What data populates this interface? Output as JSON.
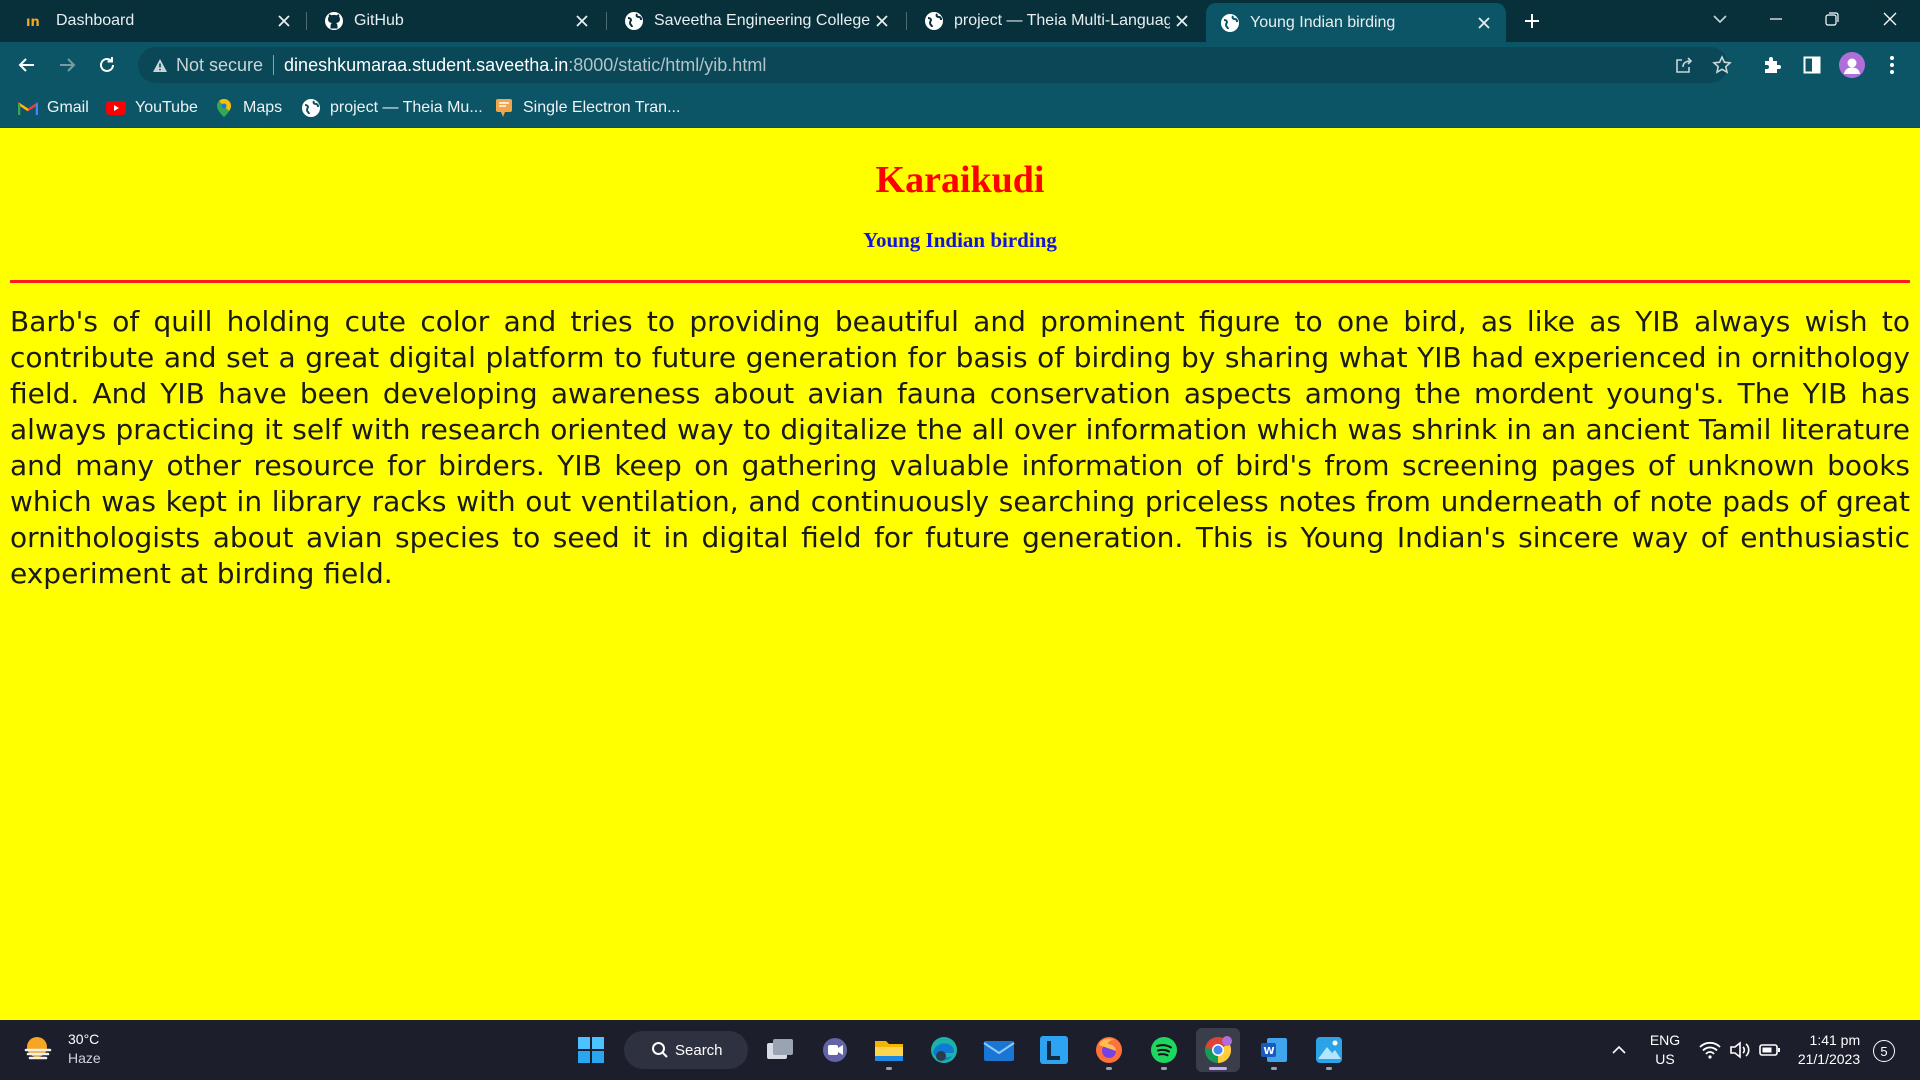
{
  "browser": {
    "tabs": [
      {
        "title": "Dashboard",
        "icon": "dashboard-favicon",
        "active": false
      },
      {
        "title": "GitHub",
        "icon": "github-icon",
        "active": false
      },
      {
        "title": "Saveetha Engineering College",
        "icon": "globe-icon",
        "active": false
      },
      {
        "title": "project — Theia Multi-Language",
        "icon": "globe-icon",
        "active": false
      },
      {
        "title": "Young Indian birding",
        "icon": "globe-icon",
        "active": true
      }
    ],
    "address": {
      "security_label": "Not secure",
      "host": "dineshkumaraa.student.saveetha.in",
      "path": ":8000/static/html/yib.html"
    },
    "bookmarks": [
      {
        "label": "Gmail",
        "icon": "gmail-icon"
      },
      {
        "label": "YouTube",
        "icon": "youtube-icon"
      },
      {
        "label": "Maps",
        "icon": "maps-icon"
      },
      {
        "label": "project — Theia Mu...",
        "icon": "globe-icon"
      },
      {
        "label": "Single Electron Tran...",
        "icon": "doc-icon"
      }
    ],
    "colors": {
      "tabstrip": "#07303b",
      "toolbar": "#0c5566"
    }
  },
  "page": {
    "heading": "Karaikudi",
    "subheading": "Young Indian birding",
    "paragraph": "Barb's of quill holding cute color and tries to providing beautiful and prominent figure to one bird, as like as YIB always wish to contribute and set a great digital platform to future generation for basis of birding by sharing what YIB had experienced in ornithology field. And YIB have been developing awareness about avian fauna conservation aspects among the mordent young's. The YIB has always practicing it self with research oriented way to digitalize the all over information which was shrink in an ancient Tamil literature and many other resource for birders. YIB keep on gathering valuable information of bird's from screening pages of unknown books which was kept in library racks with out ventilation, and continuously searching priceless notes from underneath of note pads of great ornithologists about avian species to seed it in digital field for future generation. This is Young Indian's sincere way of enthusiastic experiment at birding field.",
    "colors": {
      "background": "#ffff00",
      "heading": "#ff0000",
      "subheading": "#1515d6",
      "rule": "#ff1a1a"
    }
  },
  "taskbar": {
    "weather": {
      "temp": "30°C",
      "condition": "Haze"
    },
    "search_label": "Search",
    "apps": [
      "start-icon",
      "search-icon",
      "task-view-icon",
      "teams-chat-icon",
      "file-explorer-icon",
      "edge-icon",
      "mail-icon",
      "l-app-icon",
      "firefox-icon",
      "spotify-icon",
      "chrome-icon",
      "word-icon",
      "photos-icon"
    ],
    "language": {
      "line1": "ENG",
      "line2": "US"
    },
    "clock": {
      "time": "1:41 pm",
      "date": "21/1/2023"
    },
    "notifications": "5"
  }
}
